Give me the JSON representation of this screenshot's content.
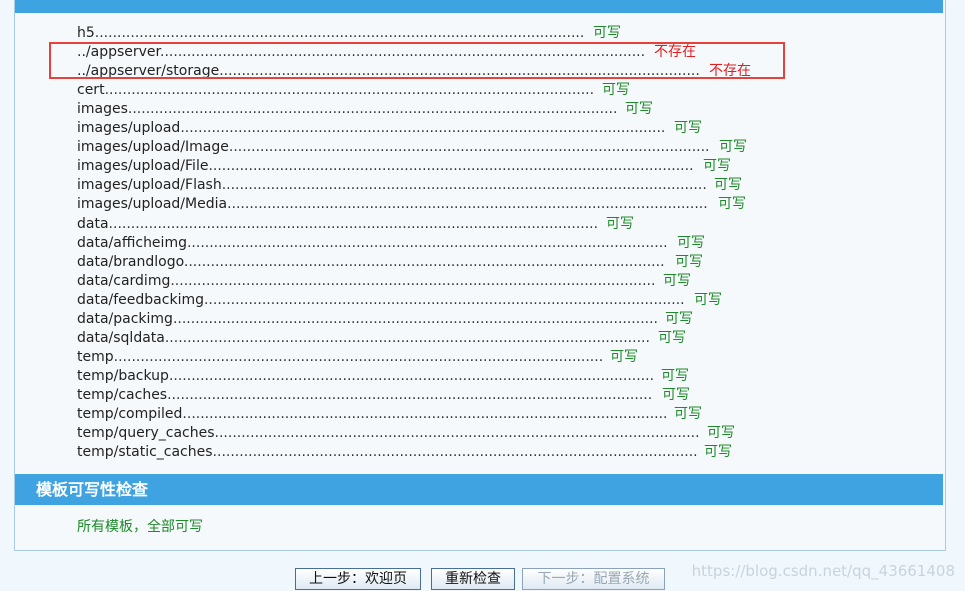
{
  "dirs": [
    {
      "path": "h5",
      "status": "可写",
      "ok": true
    },
    {
      "path": "../appserver",
      "status": "不存在",
      "ok": false
    },
    {
      "path": "../appserver/storage",
      "status": "不存在",
      "ok": false
    },
    {
      "path": "cert",
      "status": "可写",
      "ok": true
    },
    {
      "path": "images",
      "status": "可写",
      "ok": true
    },
    {
      "path": "images/upload",
      "status": "可写",
      "ok": true
    },
    {
      "path": "images/upload/Image",
      "status": "可写",
      "ok": true
    },
    {
      "path": "images/upload/File",
      "status": "可写",
      "ok": true
    },
    {
      "path": "images/upload/Flash",
      "status": "可写",
      "ok": true
    },
    {
      "path": "images/upload/Media",
      "status": "可写",
      "ok": true
    },
    {
      "path": "data",
      "status": "可写",
      "ok": true
    },
    {
      "path": "data/afficheimg",
      "status": "可写",
      "ok": true
    },
    {
      "path": "data/brandlogo",
      "status": "可写",
      "ok": true
    },
    {
      "path": "data/cardimg",
      "status": "可写",
      "ok": true
    },
    {
      "path": "data/feedbackimg",
      "status": "可写",
      "ok": true
    },
    {
      "path": "data/packimg",
      "status": "可写",
      "ok": true
    },
    {
      "path": "data/sqldata",
      "status": "可写",
      "ok": true
    },
    {
      "path": "temp",
      "status": "可写",
      "ok": true
    },
    {
      "path": "temp/backup",
      "status": "可写",
      "ok": true
    },
    {
      "path": "temp/caches",
      "status": "可写",
      "ok": true
    },
    {
      "path": "temp/compiled",
      "status": "可写",
      "ok": true
    },
    {
      "path": "temp/query_caches",
      "status": "可写",
      "ok": true
    },
    {
      "path": "temp/static_caches",
      "status": "可写",
      "ok": true
    }
  ],
  "template_section": {
    "title": "模板可写性检查",
    "result": "所有模板，全部可写"
  },
  "buttons": {
    "prev": "上一步：欢迎页",
    "recheck": "重新检查",
    "next": "下一步：配置系统"
  },
  "watermark": "https://blog.csdn.net/qq_43661408",
  "colors": {
    "section_bar": "#3ea3e0",
    "ok": "#1e8a2a",
    "missing": "#e02020",
    "highlight": "#e8413c"
  }
}
